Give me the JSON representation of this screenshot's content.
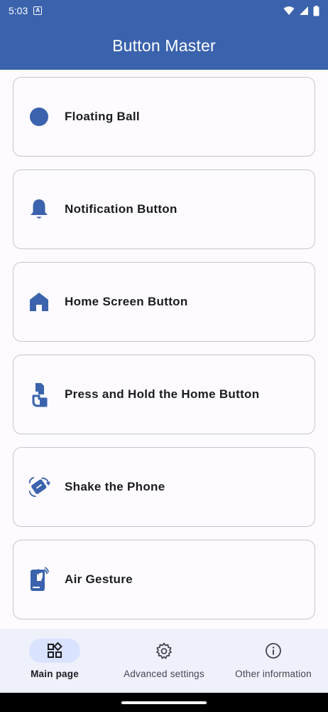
{
  "status_bar": {
    "time": "5:03",
    "notification_glyph": "A",
    "icons": [
      "wifi-icon",
      "signal-icon",
      "battery-icon"
    ]
  },
  "app_bar": {
    "title": "Button Master"
  },
  "colors": {
    "primary": "#3a62ad",
    "nav_background": "#eef0fa",
    "nav_active_pill": "#d9e2ff",
    "card_border": "#c7c6cc"
  },
  "cards": [
    {
      "label": "Floating Ball",
      "icon": "floating-ball-icon"
    },
    {
      "label": "Notification Button",
      "icon": "bell-icon"
    },
    {
      "label": "Home Screen Button",
      "icon": "home-icon"
    },
    {
      "label": "Press and Hold the Home Button",
      "icon": "press-hold-icon"
    },
    {
      "label": "Shake the Phone",
      "icon": "shake-phone-icon"
    },
    {
      "label": "Air Gesture",
      "icon": "air-gesture-icon"
    }
  ],
  "bottom_nav": {
    "items": [
      {
        "label": "Main page",
        "icon": "grid-icon",
        "active": true
      },
      {
        "label": "Advanced settings",
        "icon": "gear-icon",
        "active": false
      },
      {
        "label": "Other information",
        "icon": "info-icon",
        "active": false
      }
    ]
  }
}
